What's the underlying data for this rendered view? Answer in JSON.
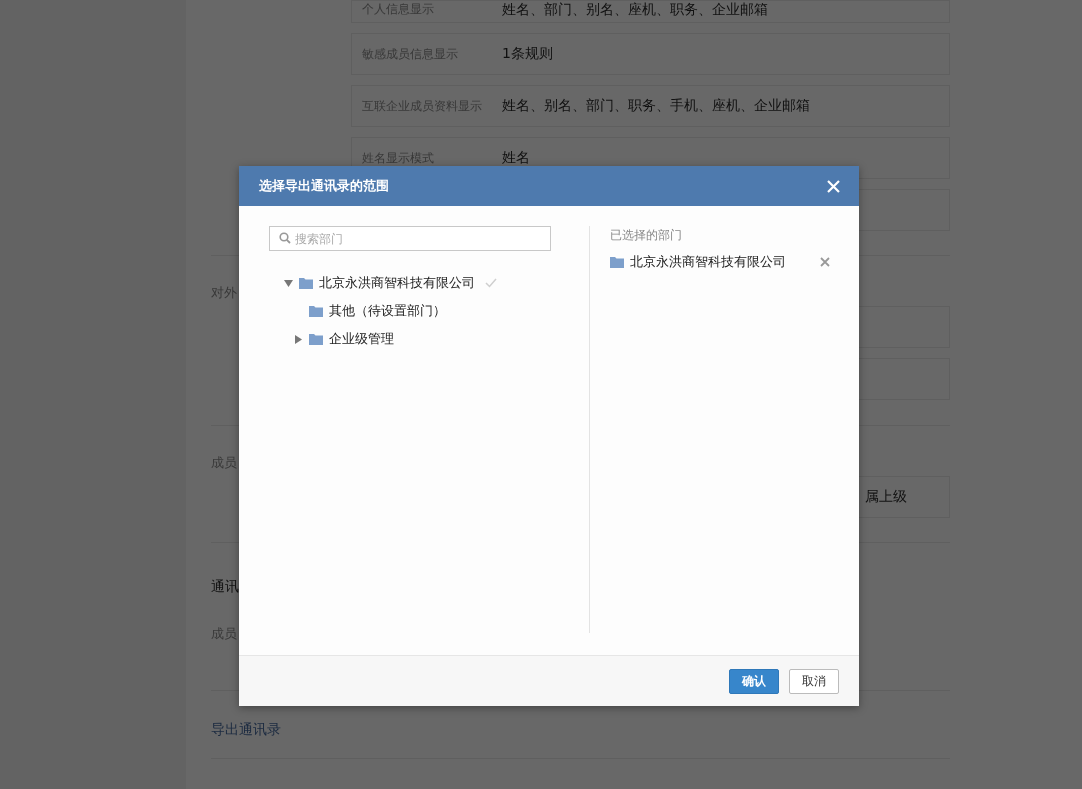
{
  "background": {
    "settings_rows": [
      {
        "label": "个人信息显示",
        "value": "姓名、部门、别名、座机、职务、企业邮箱"
      },
      {
        "label": "敏感成员信息显示",
        "value": "1条规则"
      },
      {
        "label": "互联企业成员资料显示",
        "value": "姓名、别名、部门、职务、手机、座机、企业邮箱"
      },
      {
        "label": "姓名显示模式",
        "value": "姓名"
      }
    ],
    "external_section": {
      "label": "对外"
    },
    "member_section": {
      "label": "成员",
      "value": "属上级"
    },
    "directory_section": {
      "title": "通讯",
      "label": "成员"
    },
    "export_label": "导出通讯录"
  },
  "dialog": {
    "title": "选择导出通讯录的范围",
    "search": {
      "placeholder": "搜索部门"
    },
    "tree": [
      {
        "label": "北京永洪商智科技有限公司",
        "kind": "branch",
        "expanded": true,
        "checked": true,
        "children": [
          {
            "label": "其他（待设置部门）",
            "kind": "leaf",
            "checked": false
          },
          {
            "label": "企业级管理",
            "kind": "branch",
            "expanded": false,
            "checked": false
          }
        ]
      }
    ],
    "selected_title": "已选择的部门",
    "selected_items": [
      {
        "label": "北京永洪商智科技有限公司"
      }
    ],
    "buttons": [
      {
        "label": "确认",
        "kind": "primary"
      },
      {
        "label": "取消",
        "kind": "secondary"
      }
    ]
  }
}
